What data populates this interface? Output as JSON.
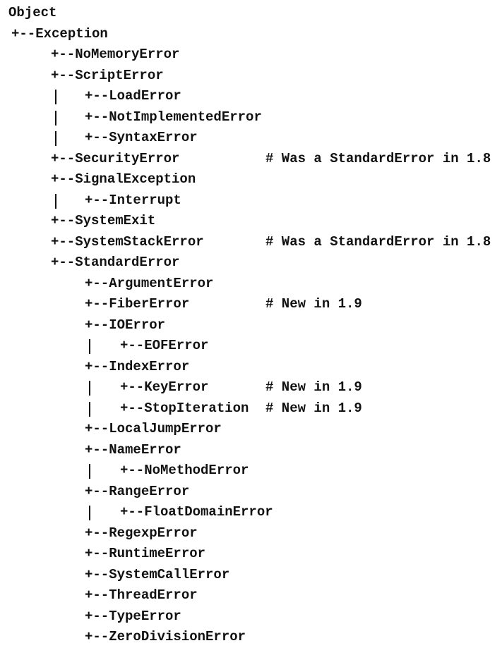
{
  "lines": [
    {
      "depth": 0,
      "text": "Object"
    },
    {
      "depth": 1,
      "text": "+--Exception"
    },
    {
      "depth": 2,
      "text": "+--NoMemoryError"
    },
    {
      "depth": 2,
      "text": "+--ScriptError"
    },
    {
      "depth": 3,
      "text": "+--LoadError",
      "bar": true
    },
    {
      "depth": 3,
      "text": "+--NotImplementedError",
      "bar": true
    },
    {
      "depth": 3,
      "text": "+--SyntaxError",
      "bar": true
    },
    {
      "depth": 2,
      "text": "+--SecurityError",
      "comment": "# Was a StandardError in 1.8"
    },
    {
      "depth": 2,
      "text": "+--SignalException"
    },
    {
      "depth": 3,
      "text": "+--Interrupt",
      "bar": true
    },
    {
      "depth": 2,
      "text": "+--SystemExit"
    },
    {
      "depth": 2,
      "text": "+--SystemStackError",
      "comment": "# Was a StandardError in 1.8"
    },
    {
      "depth": 2,
      "text": "+--StandardError"
    },
    {
      "depth": 3,
      "text": "+--ArgumentError"
    },
    {
      "depth": 3,
      "text": "+--FiberError",
      "comment": "# New in 1.9"
    },
    {
      "depth": 3,
      "text": "+--IOError"
    },
    {
      "depth": 4,
      "text": "+--EOFError",
      "bar": true
    },
    {
      "depth": 3,
      "text": "+--IndexError"
    },
    {
      "depth": 4,
      "text": "+--KeyError",
      "bar": true,
      "comment": "# New in 1.9"
    },
    {
      "depth": 4,
      "text": "+--StopIteration",
      "bar": true,
      "comment": "# New in 1.9"
    },
    {
      "depth": 3,
      "text": "+--LocalJumpError"
    },
    {
      "depth": 3,
      "text": "+--NameError"
    },
    {
      "depth": 4,
      "text": "+--NoMethodError",
      "bar": true
    },
    {
      "depth": 3,
      "text": "+--RangeError"
    },
    {
      "depth": 4,
      "text": "+--FloatDomainError",
      "bar": true
    },
    {
      "depth": 3,
      "text": "+--RegexpError"
    },
    {
      "depth": 3,
      "text": "+--RuntimeError"
    },
    {
      "depth": 3,
      "text": "+--SystemCallError"
    },
    {
      "depth": 3,
      "text": "+--ThreadError"
    },
    {
      "depth": 3,
      "text": "+--TypeError"
    },
    {
      "depth": 3,
      "text": "+--ZeroDivisionError"
    }
  ]
}
